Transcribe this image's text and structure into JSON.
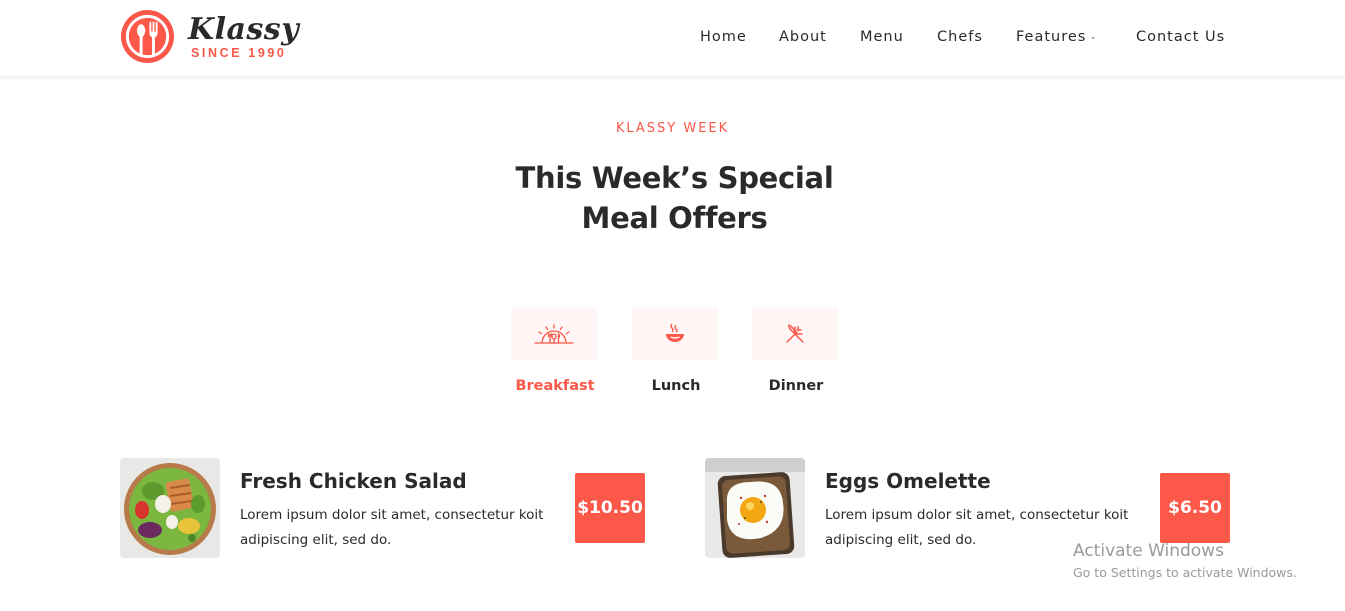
{
  "header": {
    "logo": {
      "name": "Klassy",
      "since": "SINCE 1990"
    },
    "nav": [
      {
        "label": "Home"
      },
      {
        "label": "About"
      },
      {
        "label": "Menu"
      },
      {
        "label": "Chefs"
      },
      {
        "label": "Features",
        "has_dropdown": true
      },
      {
        "label": "Contact Us"
      }
    ]
  },
  "section": {
    "eyebrow": "KLASSY WEEK",
    "title_line1": "This Week’s Special",
    "title_line2": "Meal Offers"
  },
  "tabs": [
    {
      "label": "Breakfast",
      "icon": "breakfast-icon",
      "active": true
    },
    {
      "label": "Lunch",
      "icon": "bowl-icon",
      "active": false
    },
    {
      "label": "Dinner",
      "icon": "fork-knife-icon",
      "active": false
    }
  ],
  "items": [
    {
      "name": "Fresh Chicken Salad",
      "description": "Lorem ipsum dolor sit amet, consectetur koit adipiscing elit, sed do.",
      "price": "$10.50",
      "image": "salad-bowl-image"
    },
    {
      "name": "Eggs Omelette",
      "description": "Lorem ipsum dolor sit amet, consectetur koit adipiscing elit, sed do.",
      "price": "$6.50",
      "image": "egg-toast-image"
    }
  ],
  "watermark": {
    "line1": "Activate Windows",
    "line2": "Go to Settings to activate Windows."
  },
  "colors": {
    "accent": "#fb5849",
    "text": "#2a2a2a",
    "tab_bg": "#fff6f5"
  }
}
